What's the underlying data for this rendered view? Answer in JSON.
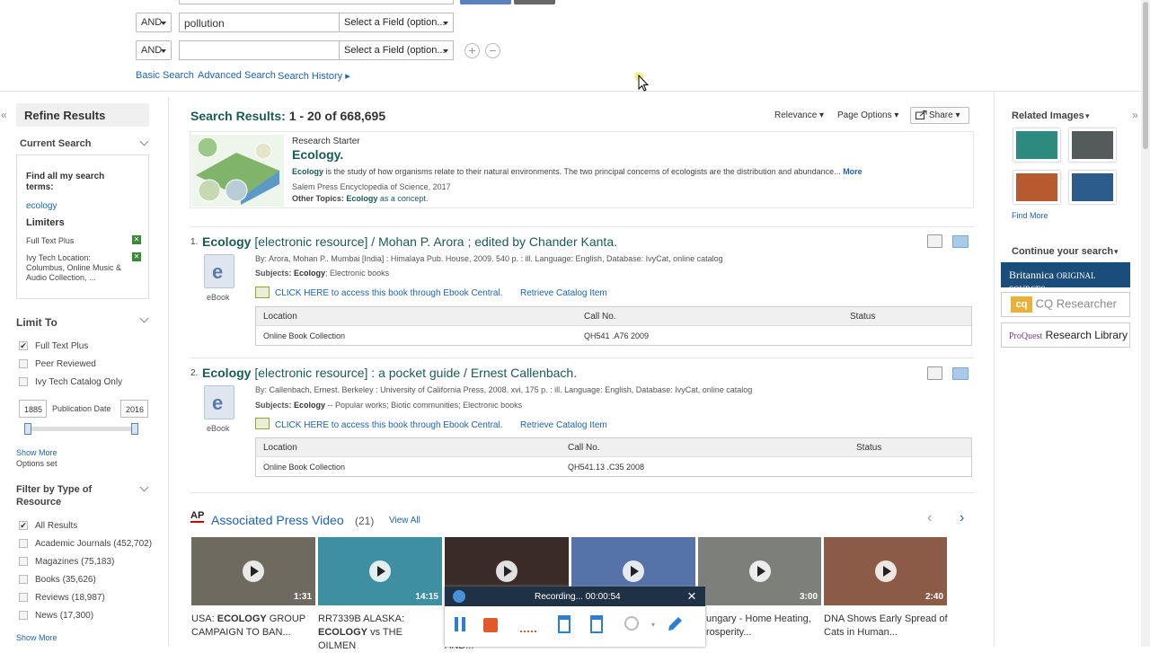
{
  "search": {
    "row2": {
      "bool": "AND",
      "value": "pollution",
      "field": "Select a Field (option..."
    },
    "row3": {
      "bool": "AND",
      "value": "",
      "field": "Select a Field (option..."
    },
    "add_icon": "plus-circle-icon",
    "remove_icon": "minus-circle-icon",
    "links": {
      "basic": "Basic Search",
      "advanced": "Advanced Search",
      "history": "Search History ▸"
    }
  },
  "sidebar": {
    "collapse_glyph": "«",
    "title": "Refine Results",
    "current_search": {
      "header": "Current Search",
      "find_all_label": "Find all my search terms:",
      "term": "ecology",
      "limiters_header": "Limiters",
      "limiters": [
        "Full Text Plus",
        "Ivy Tech Location: Columbus, Online Music & Audio Collection, ..."
      ]
    },
    "limit_to": {
      "header": "Limit To",
      "options": [
        {
          "label": "Full Text Plus",
          "checked": true
        },
        {
          "label": "Peer Reviewed",
          "checked": false
        },
        {
          "label": "Ivy Tech Catalog Only",
          "checked": false
        }
      ],
      "date_from": "1885",
      "date_label": "Publication Date",
      "date_to": "2016",
      "show_more": "Show More",
      "options_set": "Options set"
    },
    "filter_type": {
      "header": "Filter by Type of Resource",
      "options": [
        {
          "label": "All Results",
          "checked": true
        },
        {
          "label": "Academic Journals (452,702)",
          "checked": false
        },
        {
          "label": "Magazines (75,183)",
          "checked": false
        },
        {
          "label": "Books (35,626)",
          "checked": false
        },
        {
          "label": "Reviews (18,987)",
          "checked": false
        },
        {
          "label": "News (17,300)",
          "checked": false
        }
      ],
      "show_more": "Show More"
    }
  },
  "results": {
    "heading_label": "Search Results:",
    "heading_range": "1 - 20 of 668,695",
    "relevance": "Relevance",
    "page_options": "Page Options",
    "share": "Share",
    "starter": {
      "kicker": "Research Starter",
      "title": "Ecology.",
      "abstract_term": "Ecology",
      "abstract": " is the study of how organisms relate to their natural environments. The two principal concerns of ecologists are the distribution and abundance...",
      "more": "More",
      "source": "Salem Press Encyclopedia of Science, 2017",
      "other_label": "Other Topics:",
      "other_term": "Ecology",
      "other_rest": "as a concept."
    },
    "items": [
      {
        "num": "1.",
        "title_bold": "Ecology",
        "title_rest": " [electronic resource] / Mohan P. Arora ; edited by Chander Kanta.",
        "byline": "By: Arora, Mohan P.. Mumbai [India] : Himalaya Pub. House, 2009. 540 p. : ill. Language: English, Database: IvyCat, online catalog",
        "subjects_label": "Subjects:",
        "subjects_bold": "Ecology",
        "subjects_rest": "; Electronic books",
        "type": "eBook",
        "access_link": "CLICK HERE to access this book through Ebook Central.",
        "catalog_link": "Retrieve Catalog Item",
        "holding_headers": [
          "Location",
          "Call No.",
          "Status"
        ],
        "holding_row": [
          "Online Book Collection",
          "QH541 .A76 2009",
          ""
        ]
      },
      {
        "num": "2.",
        "title_bold": "Ecology",
        "title_rest": " [electronic resource] : a pocket guide / Ernest Callenbach.",
        "byline": "By: Callenbach, Ernest. Berkeley : University of California Press, 2008. xvi, 175 p. : ill. Language: English, Database: IvyCat, online catalog",
        "subjects_label": "Subjects:",
        "subjects_bold": "Ecology",
        "subjects_rest": " -- Popular works; Biotic communities; Electronic books",
        "type": "eBook",
        "access_link": "CLICK HERE to access this book through Ebook Central.",
        "catalog_link": "Retrieve Catalog Item",
        "holding_headers": [
          "Location",
          "Call No.",
          "Status"
        ],
        "holding_row": [
          "Online Book Collection",
          "QH541.13 .C35 2008",
          ""
        ]
      }
    ],
    "ap": {
      "logo": "AP",
      "title": "Associated Press Video",
      "count": "(21)",
      "view_all": "View All",
      "prev": "‹",
      "next": "›",
      "videos": [
        {
          "duration": "1:31",
          "cap1": "USA: ",
          "capb": "ECOLOGY",
          "cap2": " GROUP CAMPAIGN TO BAN...",
          "color": "#6f6a5f"
        },
        {
          "duration": "14:15",
          "cap1": "RR7339B ALASKA: ",
          "capb": "ECOLOGY",
          "cap2": " vs THE OILMEN",
          "color": "#3f8fa3"
        },
        {
          "duration": "",
          "cap1": "",
          "capb": "",
          "cap2": "AND...",
          "color": "#3a2b28"
        },
        {
          "duration": "",
          "cap1": "",
          "capb": "",
          "cap2": "",
          "color": "#5673a8"
        },
        {
          "duration": "3:00",
          "cap1": "",
          "capb": "",
          "cap2": "ungary - Home Heating, rosperity...",
          "color": "#7c7f7a"
        },
        {
          "duration": "2:40",
          "cap1": "",
          "capb": "",
          "cap2": "DNA Shows Early Spread of Cats in Human...",
          "color": "#8b5b48"
        }
      ]
    }
  },
  "right": {
    "collapse_glyph": "»",
    "related_images": "Related Images",
    "find_more": "Find More",
    "continue": "Continue your search",
    "partners": [
      "Britannica",
      "Original Sources",
      "CQ Researcher",
      "ProQuest",
      "Research Library"
    ]
  },
  "recorder": {
    "status": "Recording... 00:00:54",
    "close": "×"
  }
}
